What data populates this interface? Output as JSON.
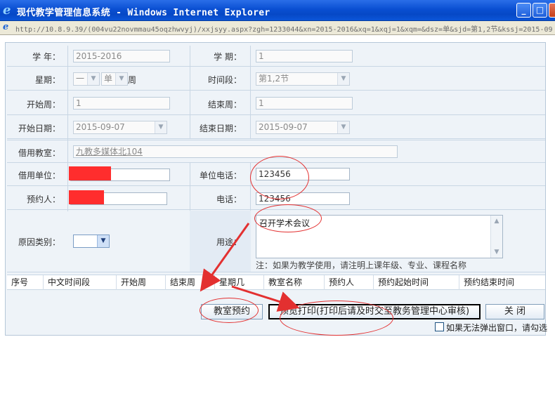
{
  "window": {
    "title": "现代教学管理信息系统 - Windows Internet Explorer",
    "address": "http://10.8.9.39/(004vu22novmmau45oqzhwvyj)/xxjsyy.aspx?zgh=1233044&xn=2015-2016&xq=1&xqj=1&xqm=&dsz=单&sjd=第1,2节&kssj=2015-09"
  },
  "form": {
    "year_label": "学  年：",
    "year_value": "2015-2016",
    "term_label": "学  期：",
    "term_value": "1",
    "weekday_label": "星期：",
    "weekday_value": "一",
    "parity_value": "单",
    "week_suffix": "周",
    "period_label": "时间段：",
    "period_value": "第1,2节",
    "start_week_label": "开始周：",
    "start_week_value": "1",
    "end_week_label": "结束周：",
    "end_week_value": "1",
    "start_date_label": "开始日期：",
    "start_date_value": "2015-09-07",
    "end_date_label": "结束日期：",
    "end_date_value": "2015-09-07",
    "room_label": "借用教室：",
    "room_value": "九教多媒体北104",
    "unit_label": "借用单位：",
    "unit_phone_label": "单位电话：",
    "unit_phone_value": "123456",
    "booker_label": "预约人：",
    "phone_label": "电话：",
    "phone_value": "123456",
    "reason_type_label": "原因类别：",
    "purpose_label": "用途：",
    "purpose_value": "召开学术会议",
    "note": "注：如果为教学使用，请注明上课年级、专业、课程名称"
  },
  "table": {
    "headers": [
      "序号",
      "中文时间段",
      "开始周",
      "结束周",
      "星期几",
      "教室名称",
      "预约人",
      "预约起始时间",
      "预约结束时间"
    ]
  },
  "buttons": {
    "reserve": "教室预约",
    "preview_print": "预览打印(打印后请及时交至教务管理中心审核)",
    "close": "关  闭"
  },
  "popup_checkbox_label": "如果无法弹出窗口，请勾选",
  "colors": {
    "titlebar": "#0a4fd2",
    "annotation": "#e33030",
    "redaction": "#ff2d2d"
  }
}
